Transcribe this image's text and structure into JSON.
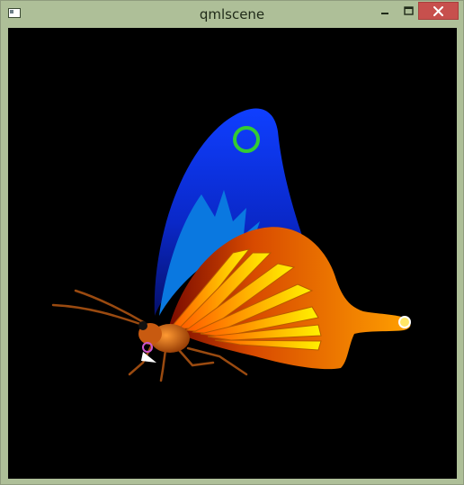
{
  "window": {
    "title": "qmlscene",
    "controls": {
      "minimize_icon": "minimize-icon",
      "maximize_icon": "maximize-icon",
      "close_icon": "close-icon"
    },
    "close_button_color": "#c7504d",
    "frame_color": "#aebf98"
  },
  "scene": {
    "background": "#000000",
    "content": "butterfly-image",
    "colors": {
      "upper_wing": "#0a2fd6",
      "lower_wing": "#e86a00",
      "feathers": "#ffe000",
      "target_ring": "#33cc33"
    }
  }
}
